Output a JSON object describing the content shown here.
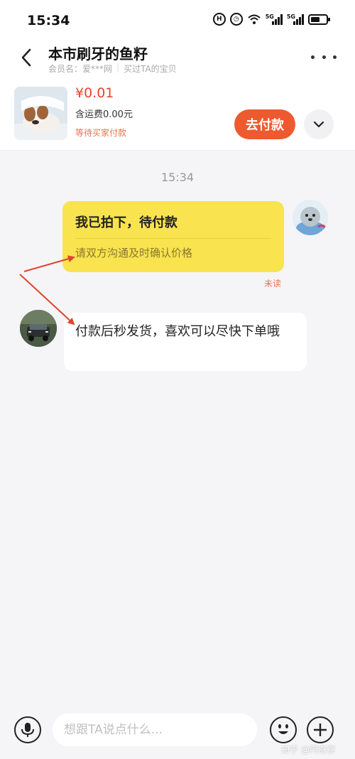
{
  "status_bar": {
    "time": "15:34",
    "net_label_1": "5G",
    "net_label_2": "5G"
  },
  "header": {
    "title": "本市刷牙的鱼籽",
    "member_label": "会员名：爱***网",
    "bought_label": "买过TA的宝贝"
  },
  "order": {
    "price": "¥0.01",
    "shipping": "含运费0.00元",
    "status": "等待买家付款",
    "pay_button": "去付款"
  },
  "chat": {
    "time": "15:34",
    "messages": [
      {
        "sender": "me",
        "title": "我已拍下，待付款",
        "subtitle": "请双方沟通及时确认价格",
        "read_status": "未读"
      },
      {
        "sender": "them",
        "text": "付款后秒发货，喜欢可以尽快下单哦"
      }
    ]
  },
  "input": {
    "placeholder": "想跟TA说点什么..."
  },
  "watermark": "知乎 @阿奇察",
  "colors": {
    "accent": "#ee5a2f",
    "price": "#e8452a",
    "system_bubble": "#f9e34f",
    "annotation_arrow": "#e0442c"
  },
  "icons": [
    "back-icon",
    "more-icon",
    "chevron-down-icon",
    "microphone-icon",
    "emoji-icon",
    "plus-icon"
  ]
}
